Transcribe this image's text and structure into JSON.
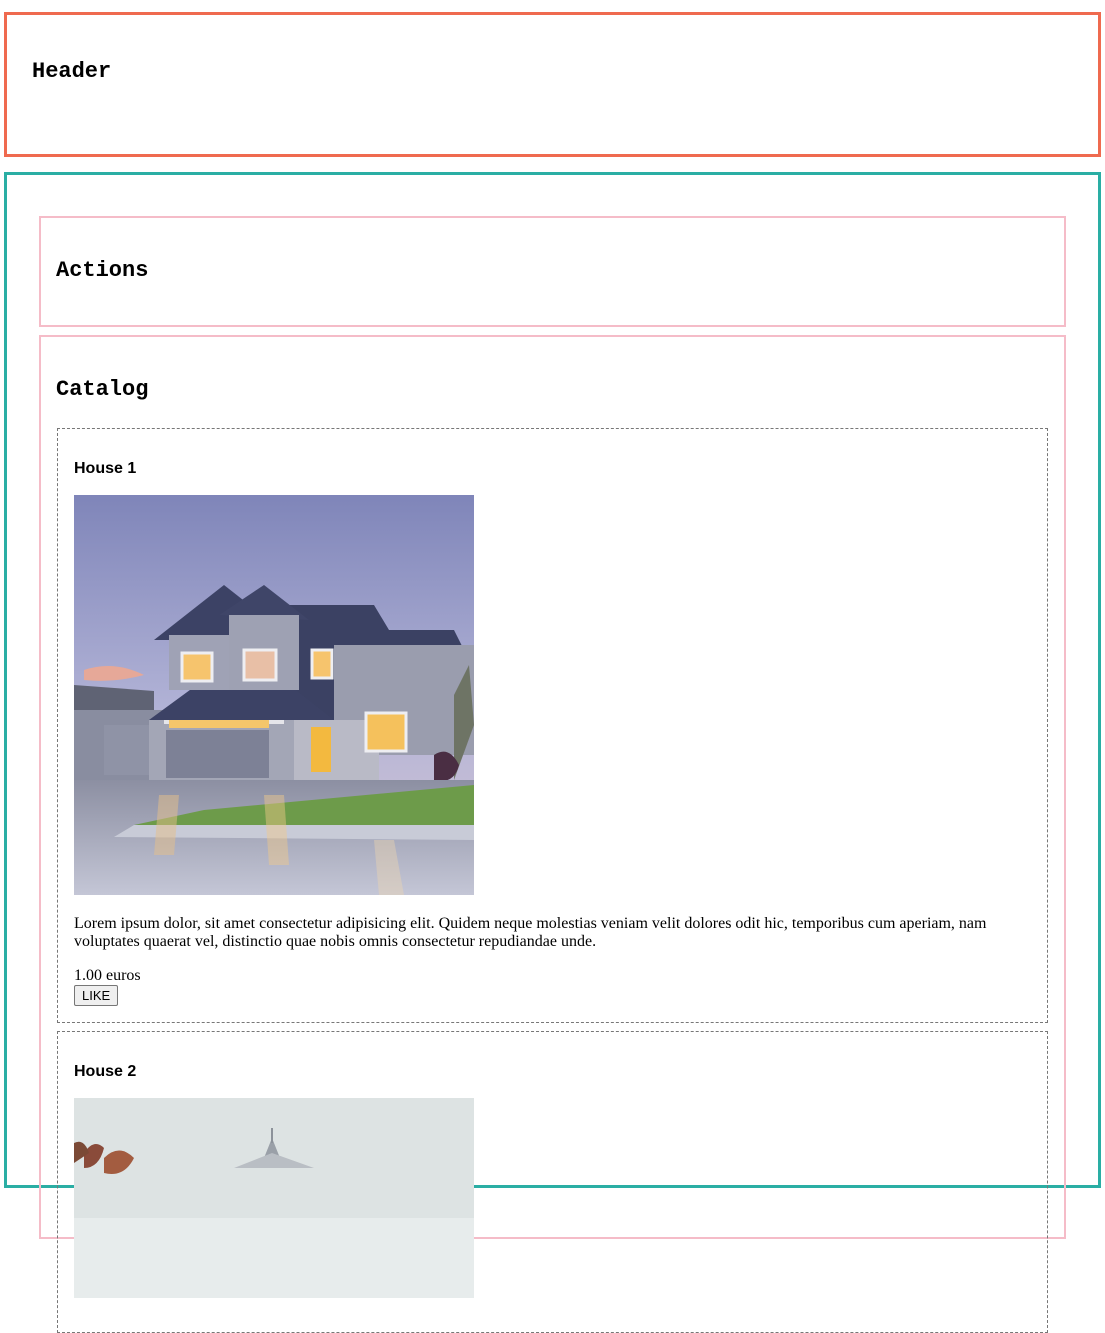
{
  "header": {
    "title": "Header"
  },
  "actions": {
    "title": "Actions"
  },
  "catalog": {
    "title": "Catalog",
    "items": [
      {
        "title": "House 1",
        "image_icon": "house-photo",
        "description": "Lorem ipsum dolor, sit amet consectetur adipisicing elit. Quidem neque molestias veniam velit dolores odit hic, temporibus cum aperiam, nam voluptates quaerat vel, distinctio quae nobis omnis consectetur repudiandae unde.",
        "price": "1.00 euros",
        "like_label": "LIKE"
      },
      {
        "title": "House 2",
        "image_icon": "house-photo"
      }
    ]
  },
  "colors": {
    "header_border": "#ef6a4f",
    "main_border": "#2aaea4",
    "section_border": "#f5bcc8",
    "card_border": "#777777"
  }
}
